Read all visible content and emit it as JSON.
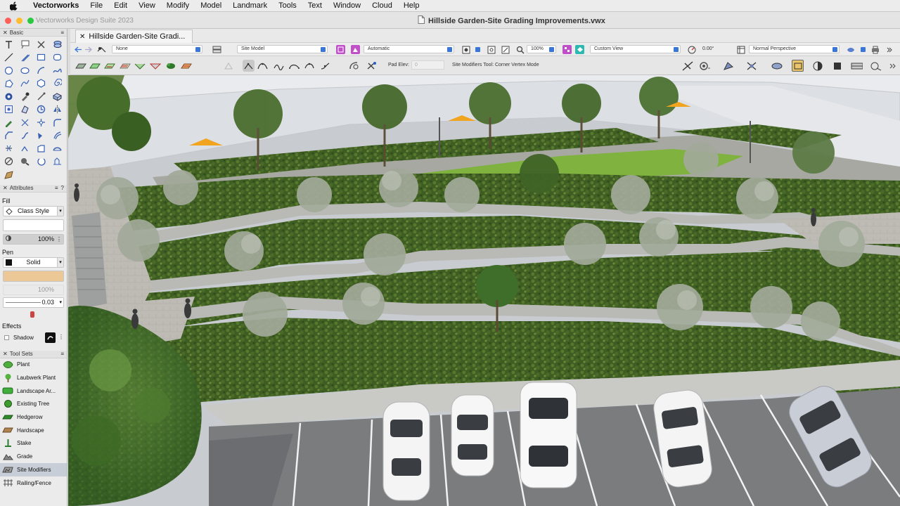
{
  "menubar": {
    "app_name": "Vectorworks",
    "items": [
      "File",
      "Edit",
      "View",
      "Modify",
      "Model",
      "Landmark",
      "Tools",
      "Text",
      "Window",
      "Cloud",
      "Help"
    ]
  },
  "window": {
    "suite_name": "Vectorworks Design Suite 2023",
    "document_title": "Hillside Garden-Site Grading Improvements.vwx",
    "tab_label": "Hillside Garden-Site Gradi..."
  },
  "view_bar": {
    "class": "None",
    "layer": "Site Model",
    "render_mode": "Automatic",
    "zoom": "100%",
    "view": "Custom View",
    "rotation": "0.00°",
    "projection": "Normal Perspective"
  },
  "mode_bar": {
    "pad_elev_label": "Pad Elev:",
    "pad_elev_value": "0",
    "hint": "Site Modifiers Tool: Corner Vertex Mode"
  },
  "palettes": {
    "basic_title": "Basic",
    "attributes": {
      "title": "Attributes",
      "help": "?",
      "fill_label": "Fill",
      "fill_style": "Class Style",
      "fill_opacity": "100%",
      "pen_label": "Pen",
      "pen_style": "Solid",
      "pen_color": "#ecc896",
      "pen_opacity": "100%",
      "line_weight": "0.03",
      "effects_label": "Effects",
      "shadow_label": "Shadow"
    },
    "tool_sets": {
      "title": "Tool Sets",
      "items": [
        {
          "label": "Plant",
          "icon": "plant-icon"
        },
        {
          "label": "Laubwerk Plant",
          "icon": "laubwerk-plant-icon"
        },
        {
          "label": "Landscape Ar...",
          "icon": "landscape-area-icon"
        },
        {
          "label": "Existing Tree",
          "icon": "existing-tree-icon"
        },
        {
          "label": "Hedgerow",
          "icon": "hedgerow-icon"
        },
        {
          "label": "Hardscape",
          "icon": "hardscape-icon"
        },
        {
          "label": "Stake",
          "icon": "stake-icon"
        },
        {
          "label": "Grade",
          "icon": "grade-icon"
        },
        {
          "label": "Site Modifiers",
          "icon": "site-modifiers-icon"
        },
        {
          "label": "Railing/Fence",
          "icon": "railing-fence-icon"
        }
      ],
      "active": "Site Modifiers"
    }
  },
  "colors": {
    "accent": "#3a76d8",
    "lawn": "#7fb23e",
    "planting": "#3e5e24",
    "path": "#b9bab5",
    "asphalt": "#7a7c7e",
    "umbrella": "#f0a420"
  }
}
